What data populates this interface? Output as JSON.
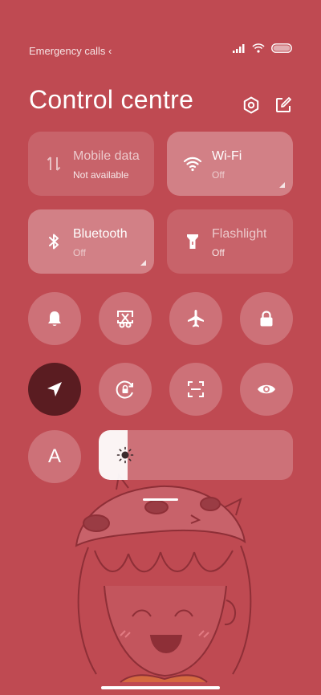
{
  "status_bar": {
    "carrier_text": "Emergency calls ‹",
    "icons": [
      "signal-icon",
      "wifi-icon",
      "battery-icon"
    ]
  },
  "header": {
    "title": "Control centre",
    "icons": [
      "settings-icon",
      "edit-icon"
    ]
  },
  "tiles": [
    {
      "label": "Mobile data",
      "sub": "Not available",
      "icon": "mobile-data-icon",
      "state": "unavailable"
    },
    {
      "label": "Wi-Fi",
      "sub": "Off",
      "icon": "wifi-icon",
      "state": "off"
    },
    {
      "label": "Bluetooth",
      "sub": "Off",
      "icon": "bluetooth-icon",
      "state": "off"
    },
    {
      "label": "Flashlight",
      "sub": "Off",
      "icon": "flashlight-icon",
      "state": "off"
    }
  ],
  "toggles_row1": [
    {
      "icon": "bell-icon",
      "active": false
    },
    {
      "icon": "screenshot-icon",
      "active": false
    },
    {
      "icon": "airplane-icon",
      "active": false
    },
    {
      "icon": "lock-icon",
      "active": false
    }
  ],
  "toggles_row2": [
    {
      "icon": "location-icon",
      "active": true
    },
    {
      "icon": "rotation-lock-icon",
      "active": false
    },
    {
      "icon": "scan-icon",
      "active": false
    },
    {
      "icon": "eye-icon",
      "active": false
    }
  ],
  "auto_brightness": {
    "label": "A",
    "active": false
  },
  "brightness": {
    "level": 0.15
  },
  "colors": {
    "background": "#bf4a52",
    "active_toggle": "#5a1c21"
  }
}
